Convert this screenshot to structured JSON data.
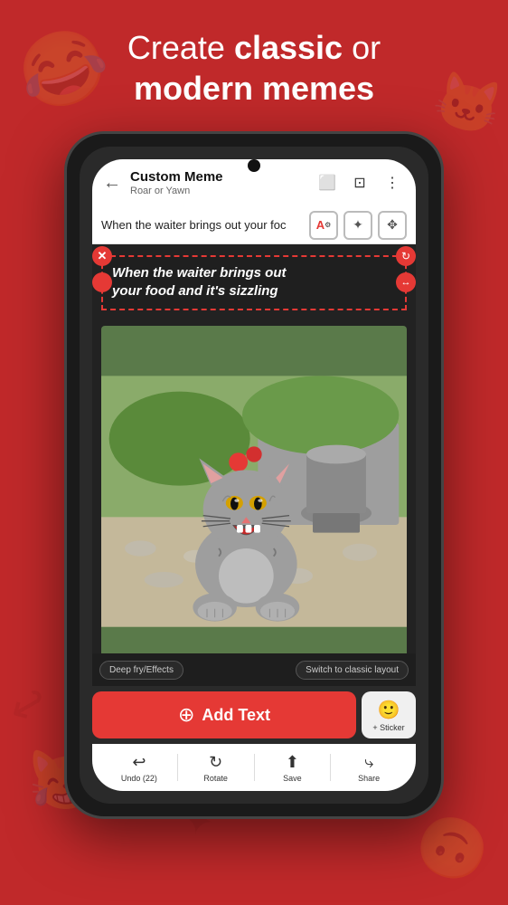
{
  "hero": {
    "line1_normal": "Create ",
    "line1_bold": "classic",
    "line1_suffix": " or",
    "line2": "modern memes"
  },
  "app_bar": {
    "back_icon": "←",
    "title": "Custom Meme",
    "subtitle": "Roar or Yawn",
    "icon1": "⬜",
    "icon2": "⊡",
    "icon3": "⋮"
  },
  "text_input": {
    "value": "When the waiter brings out your foc",
    "tool1": "A",
    "tool2": "✦",
    "tool3": "✥"
  },
  "meme_text": {
    "line1": "When the waiter brings out",
    "line2": "your food and it's sizzling"
  },
  "canvas_bottom": {
    "deep_fry": "Deep fry/Effects",
    "switch_layout": "Switch to classic layout"
  },
  "add_text": {
    "icon": "⊕",
    "label": "Add Text"
  },
  "sticker": {
    "icon": "🙂",
    "label": "+ Sticker"
  },
  "bottom_nav": {
    "items": [
      {
        "icon": "↩",
        "label": "Undo (22)"
      },
      {
        "icon": "↻",
        "label": "Rotate"
      },
      {
        "icon": "⬆",
        "label": "Save"
      },
      {
        "icon": "⤷",
        "label": "Share"
      }
    ]
  }
}
